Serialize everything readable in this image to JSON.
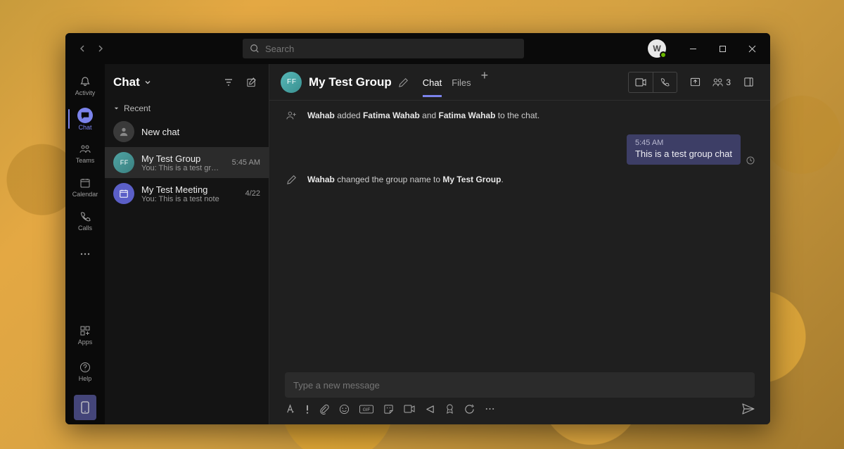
{
  "titlebar": {
    "search_placeholder": "Search",
    "avatar_initial": "W"
  },
  "rail": {
    "activity": "Activity",
    "chat": "Chat",
    "teams": "Teams",
    "calendar": "Calendar",
    "calls": "Calls",
    "apps": "Apps",
    "help": "Help"
  },
  "chatlist": {
    "header": "Chat",
    "section_recent": "Recent",
    "items": [
      {
        "name": "New chat",
        "preview": "",
        "time": ""
      },
      {
        "name": "My Test Group",
        "preview": "You: This is a test group chat",
        "time": "5:45 AM"
      },
      {
        "name": "My Test Meeting",
        "preview": "You: This is a test note",
        "time": "4/22"
      }
    ]
  },
  "conv": {
    "title": "My Test Group",
    "avatar_text": "F F",
    "tabs": {
      "chat": "Chat",
      "files": "Files"
    },
    "participant_count": "3"
  },
  "msgs": {
    "sys_add": {
      "actor": "Wahab",
      "verb": " added ",
      "p1": "Fatima Wahab",
      "mid": " and ",
      "p2": "Fatima Wahab",
      "tail": " to the chat."
    },
    "out": {
      "time": "5:45 AM",
      "body": "This is a test group chat"
    },
    "sys_rename": {
      "actor": "Wahab",
      "verb": " changed the group name to ",
      "newname": "My Test Group",
      "tail": "."
    }
  },
  "composer": {
    "placeholder": "Type a new message"
  }
}
